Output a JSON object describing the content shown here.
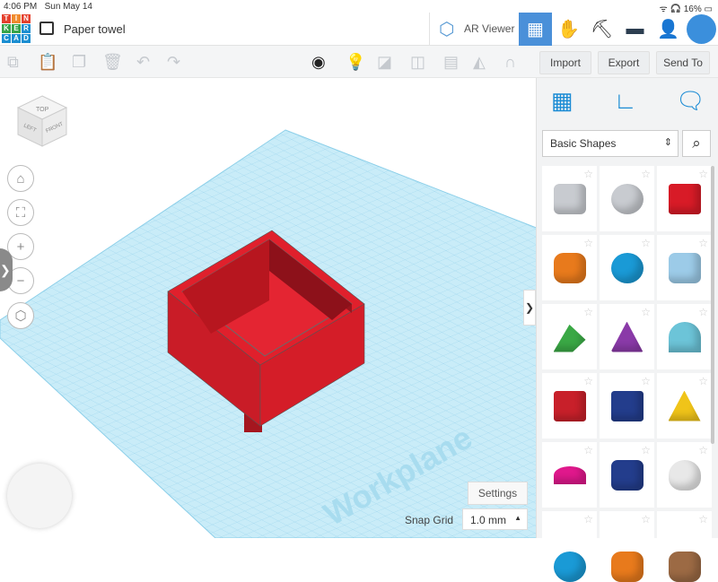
{
  "status": {
    "time": "4:06 PM",
    "date": "Sun May 14",
    "battery": "16%"
  },
  "logo": [
    "T",
    "I",
    "N",
    "K",
    "E",
    "R",
    "C",
    "A",
    "D"
  ],
  "header": {
    "title": "Paper towel",
    "ar_viewer": "AR Viewer"
  },
  "toolbar": {
    "import": "Import",
    "export": "Export",
    "send_to": "Send To"
  },
  "viewcube": {
    "top": "TOP",
    "front": "FRONT",
    "left": "LEFT"
  },
  "panel": {
    "category": "Basic Shapes",
    "shapes": [
      "Box Hole",
      "Cylinder Hole",
      "Box",
      "Cylinder",
      "Sphere",
      "Scribble",
      "Roof",
      "Cone",
      "Round Roof",
      "Text",
      "Wedge",
      "Pyramid",
      "Half Sphere",
      "Polygon",
      "Paraboloid",
      "Torus",
      "Tube",
      "Shape"
    ]
  },
  "workplane": {
    "label": "Workplane",
    "settings": "Settings",
    "snap_label": "Snap Grid",
    "snap_value": "1.0 mm"
  },
  "colors": {
    "accent": "#1a8bd4",
    "box": "#e0202c",
    "grid": "#bfe6f5"
  }
}
